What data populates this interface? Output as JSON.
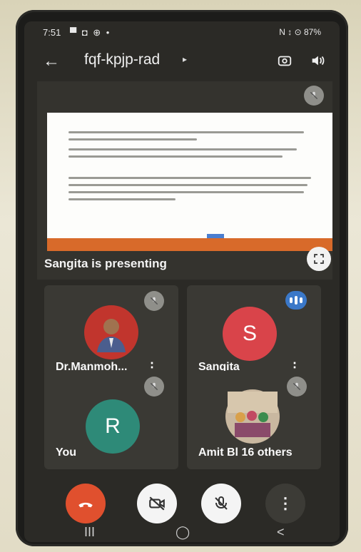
{
  "status": {
    "time": "7:51",
    "left_icons": "▀ ◘ ⊕ •",
    "right_icons": "N ↕ ⊙ 87%"
  },
  "meeting": {
    "code": "fqf-kpjp-rad",
    "caret": "▸"
  },
  "presentation": {
    "label": "Sangita is presenting"
  },
  "participants": [
    {
      "name": "Dr.Manmoh...",
      "avatar_letter": "",
      "avatar_color": "#c1352d",
      "state": "muted"
    },
    {
      "name": "Sangita",
      "avatar_letter": "S",
      "avatar_color": "#d9444a",
      "state": "speaking"
    },
    {
      "name": "You",
      "avatar_letter": "R",
      "avatar_color": "#2e8a78",
      "state": "muted"
    },
    {
      "name": "Amit Bl 16 others",
      "avatar_letter": "",
      "avatar_color": "#c9b8a0",
      "state": "muted"
    }
  ],
  "controls": {
    "end_call_icon": "phone-hangup-icon",
    "camera_icon": "camera-off-icon",
    "mic_icon": "mic-off-icon",
    "more_icon": "more-vertical-icon"
  },
  "nav": {
    "recents": "III",
    "home": "◯",
    "back": "<"
  },
  "colors": {
    "end_call": "#e0502e",
    "accent_blue": "#3b78c8"
  }
}
